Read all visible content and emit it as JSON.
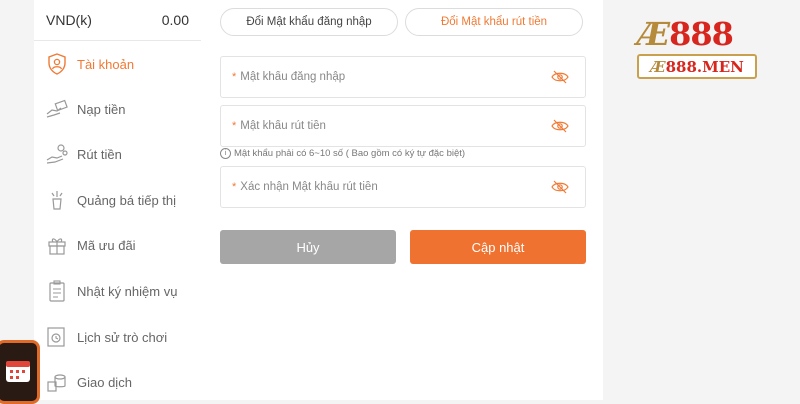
{
  "balance": {
    "currency": "VND(k)",
    "amount": "0.00"
  },
  "sidebar": {
    "items": [
      {
        "label": "Tài khoản",
        "icon": "shield-user-icon",
        "active": true
      },
      {
        "label": "Nạp tiền",
        "icon": "deposit-hand-icon"
      },
      {
        "label": "Rút tiền",
        "icon": "withdraw-hand-icon"
      },
      {
        "label": "Quảng bá tiếp thị",
        "icon": "promotion-icon"
      },
      {
        "label": "Mã ưu đãi",
        "icon": "gift-icon"
      },
      {
        "label": "Nhật ký nhiệm vụ",
        "icon": "clipboard-icon"
      },
      {
        "label": "Lịch sử trò chơi",
        "icon": "game-history-icon"
      },
      {
        "label": "Giao dịch",
        "icon": "transaction-icon"
      }
    ]
  },
  "tabs": [
    {
      "label": "Đổi Mật khẩu đăng nhập",
      "active": false
    },
    {
      "label": "Đổi Mật khẩu rút tiền",
      "active": true
    }
  ],
  "form": {
    "required_mark": "*",
    "login_password": {
      "placeholder": "Mật khẩu đăng nhập",
      "value": ""
    },
    "withdraw_password": {
      "placeholder": "Mật khẩu rút tiền",
      "value": ""
    },
    "hint": "Mật khẩu phải có 6~10 số ( Bao gồm có ký tự đặc biệt)",
    "confirm_password": {
      "placeholder": "Xác nhận Mật khẩu rút tiền",
      "value": ""
    },
    "cancel_label": "Hủy",
    "update_label": "Cập nhật"
  },
  "logo": {
    "top": "888",
    "bottom": "888.MEN"
  },
  "colors": {
    "accent": "#f07a35",
    "cancel": "#a6a6a6",
    "update": "#f07230",
    "brand_gold": "#b58a3b",
    "brand_red": "#d7261e"
  }
}
